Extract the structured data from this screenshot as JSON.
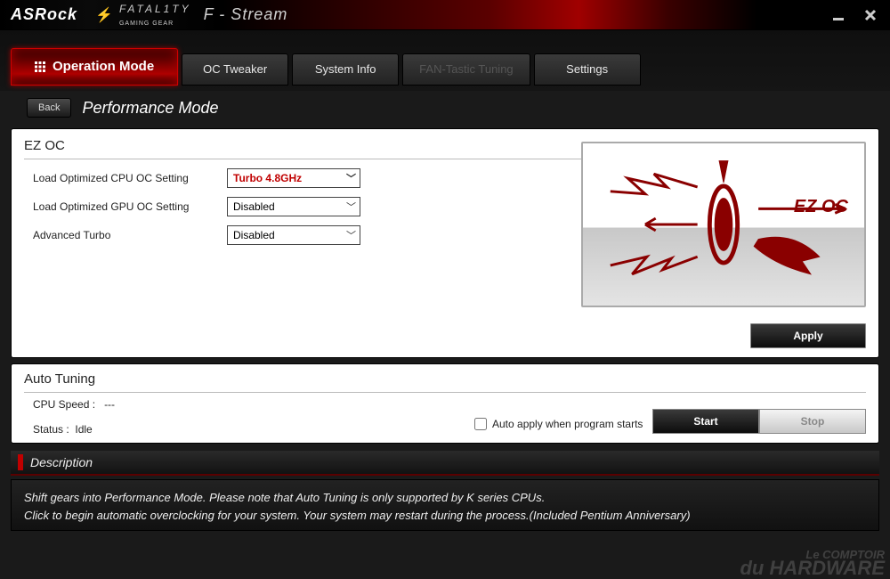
{
  "titlebar": {
    "brand": "ASRock",
    "fatality_line1": "FATAL1TY",
    "fatality_line2": "GAMING GEAR",
    "app_name": "F - Stream"
  },
  "tabs": {
    "operation_mode": "Operation Mode",
    "oc_tweaker": "OC Tweaker",
    "system_info": "System Info",
    "fan_tuning": "FAN-Tastic Tuning",
    "settings": "Settings"
  },
  "page": {
    "back": "Back",
    "title": "Performance Mode"
  },
  "ezoc": {
    "section": "EZ OC",
    "cpu_label": "Load Optimized CPU OC Setting",
    "cpu_value": "Turbo 4.8GHz",
    "gpu_label": "Load Optimized GPU OC Setting",
    "gpu_value": "Disabled",
    "adv_label": "Advanced Turbo",
    "adv_value": "Disabled",
    "illus_label": "EZ OC",
    "apply": "Apply"
  },
  "autotune": {
    "section": "Auto Tuning",
    "cpu_speed_label": "CPU Speed :",
    "cpu_speed_value": "---",
    "status_label": "Status :",
    "status_value": "Idle",
    "auto_apply": "Auto apply when program starts",
    "start": "Start",
    "stop": "Stop"
  },
  "description": {
    "heading": "Description",
    "line1": "Shift gears into Performance Mode. Please note that Auto Tuning is only supported by K series CPUs.",
    "line2": "Click to begin automatic overclocking for your system. Your system may restart during the process.(Included Pentium Anniversary)"
  },
  "watermark": {
    "line1": "Le COMPTOIR",
    "line2": "du HARDWARE"
  }
}
